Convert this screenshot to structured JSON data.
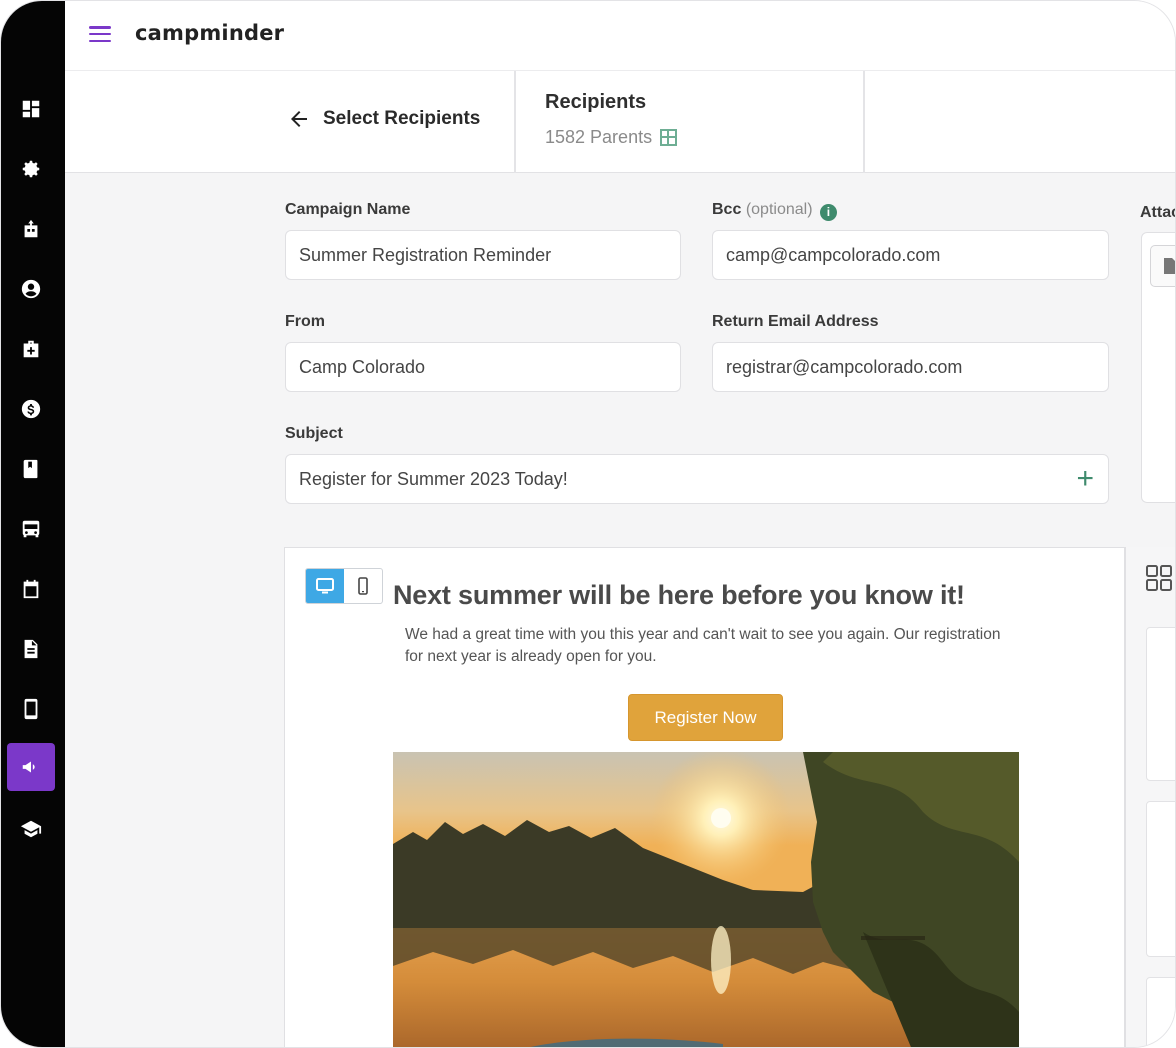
{
  "app": {
    "brand": "campminder"
  },
  "sidebar": {
    "items": [
      {
        "icon": "dashboard-icon"
      },
      {
        "icon": "gear-icon"
      },
      {
        "icon": "cabin-icon"
      },
      {
        "icon": "person-icon"
      },
      {
        "icon": "medical-kit-icon"
      },
      {
        "icon": "dollar-icon"
      },
      {
        "icon": "book-icon"
      },
      {
        "icon": "bus-icon"
      },
      {
        "icon": "calendar-icon"
      },
      {
        "icon": "document-icon"
      },
      {
        "icon": "mobile-icon"
      },
      {
        "icon": "megaphone-icon",
        "active": true
      },
      {
        "icon": "graduation-cap-icon"
      }
    ]
  },
  "header": {
    "back_label": "Select Recipients",
    "recipients_title": "Recipients",
    "recipients_count": "1582 Parents"
  },
  "form": {
    "campaign_name_label": "Campaign Name",
    "campaign_name_value": "Summer Registration Reminder",
    "bcc_label": "Bcc",
    "bcc_optional": "(optional)",
    "bcc_value": "camp@campcolorado.com",
    "from_label": "From",
    "from_value": "Camp Colorado",
    "return_label": "Return Email Address",
    "return_value": "registrar@campcolorado.com",
    "subject_label": "Subject",
    "subject_value": "Register for Summer 2023 Today!",
    "attachments_label": "Attac"
  },
  "email": {
    "heading": "Next summer will be here before you know it!",
    "body": "We had a great time with you this year and can't wait to see you again. Our registration for next year is already open for you.",
    "cta_label": "Register Now"
  },
  "colors": {
    "accent": "#7b38c9",
    "green": "#3f8b6d",
    "cta": "#e0a33b",
    "toggle_active": "#3ea8e5"
  }
}
